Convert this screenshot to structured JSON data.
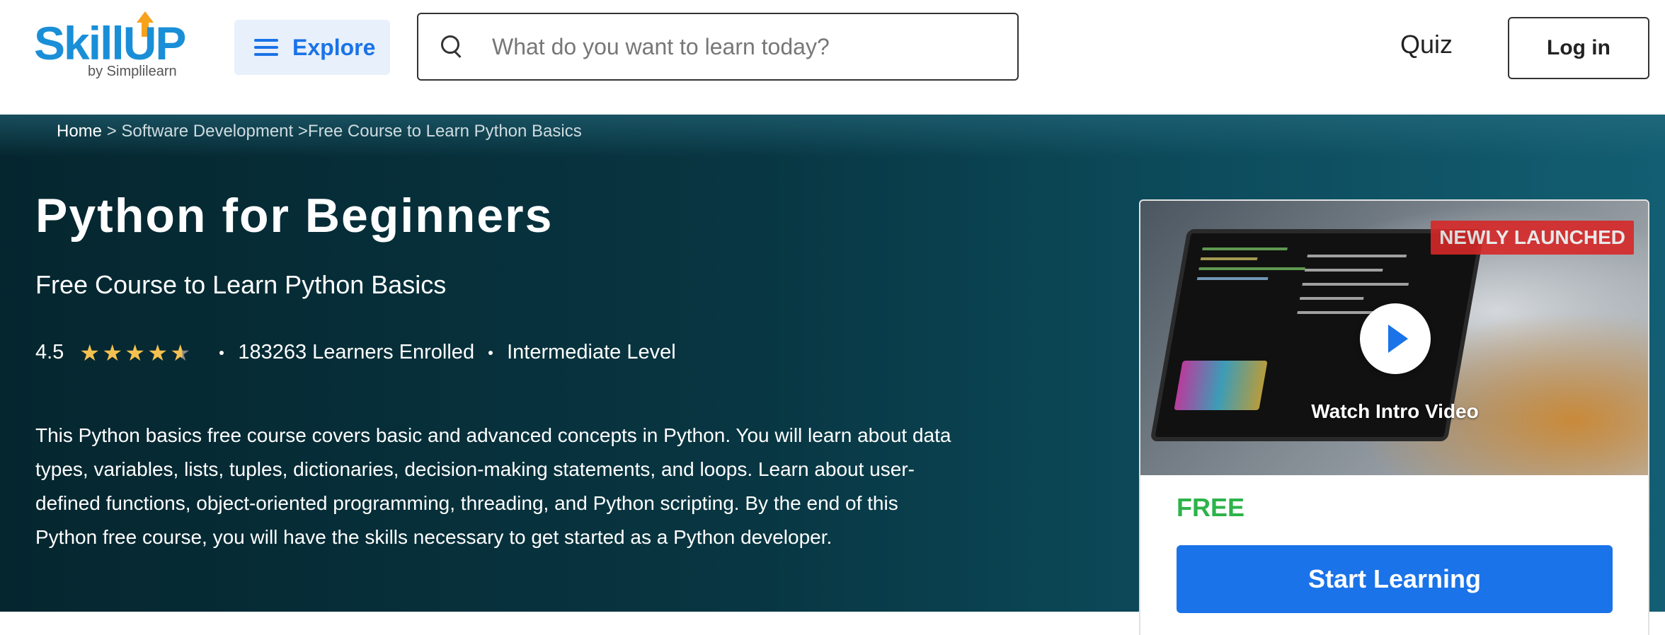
{
  "header": {
    "logo_text": "SkillUP",
    "logo_sub": "by Simplilearn",
    "explore_label": "Explore",
    "search_placeholder": "What do you want to learn today?",
    "quiz_label": "Quiz",
    "login_label": "Log in"
  },
  "breadcrumb": {
    "home": "Home",
    "sep1": " > ",
    "category": "Software Development",
    "sep2": " >",
    "current": "Free Course to Learn Python Basics"
  },
  "course": {
    "title": "Python for Beginners",
    "subtitle": "Free Course to Learn Python Basics",
    "rating": "4.5",
    "rating_value": 4.5,
    "learners": "183263 Learners Enrolled",
    "level": "Intermediate Level",
    "description": "This Python basics free course covers basic and advanced concepts in Python. You will learn about data types, variables, lists, tuples, dictionaries, decision-making statements, and loops. Learn about user-defined functions, object-oriented programming, threading, and Python scripting. By the end of this Python free course, you will have the skills necessary to get started as a Python developer."
  },
  "card": {
    "badge": "NEWLY LAUNCHED",
    "watch_label": "Watch Intro Video",
    "price": "FREE",
    "cta_label": "Start Learning"
  },
  "colors": {
    "brand_blue": "#1a73e8",
    "price_green": "#2db34a",
    "star": "#f4c150",
    "hero_bg": "#083642"
  },
  "icons": [
    "menu-icon",
    "search-icon",
    "star-icon",
    "play-icon"
  ]
}
